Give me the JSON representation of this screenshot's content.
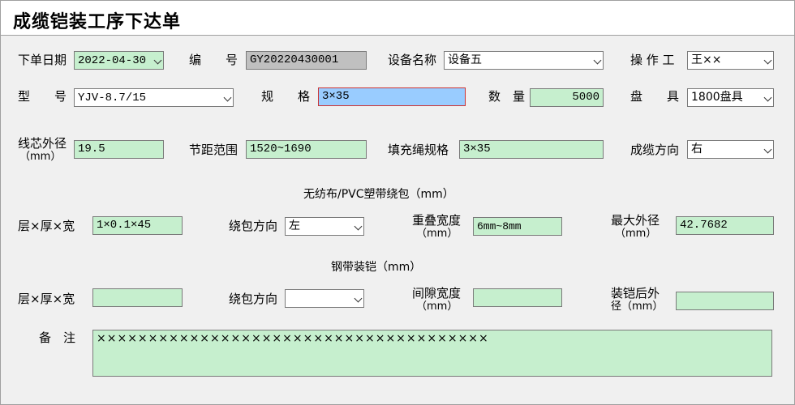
{
  "title": "成缆铠装工序下达单",
  "row1": {
    "order_date_label": "下单日期",
    "order_date_value": "2022-04-30",
    "code_label": "编　　号",
    "code_value": "GY20220430001",
    "equipment_label": "设备名称",
    "equipment_value": "设备五",
    "operator_label": "操 作 工",
    "operator_value": "王××"
  },
  "row2": {
    "model_label": "型　　号",
    "model_value": "YJV-8.7/15",
    "spec_label": "规　　格",
    "spec_value": "3×35",
    "qty_label": "数　量",
    "qty_value": "5000",
    "reel_label": "盘　　具",
    "reel_value": "1800盘具"
  },
  "row3": {
    "core_od_label": "线芯外径",
    "core_od_unit": "（mm）",
    "core_od_value": "19.5",
    "pitch_label": "节距范围",
    "pitch_value": "1520~1690",
    "filler_label": "填充绳规格",
    "filler_value": "3×35",
    "cabling_dir_label": "成缆方向",
    "cabling_dir_value": "右"
  },
  "section_nonwoven": "无纺布/PVC塑带绕包（mm）",
  "row4": {
    "layers_label": "层×厚×宽",
    "layers_value": "1×0.1×45",
    "wrap_dir_label": "绕包方向",
    "wrap_dir_value": "左",
    "overlap_label": "重叠宽度",
    "overlap_unit": "（mm）",
    "overlap_value": "6mm~8mm",
    "max_od_label": "最大外径",
    "max_od_unit": "（mm）",
    "max_od_value": "42.7682"
  },
  "section_steel": "钢带装铠（mm）",
  "row5": {
    "layers_label": "层×厚×宽",
    "layers_value": "",
    "wrap_dir_label": "绕包方向",
    "wrap_dir_value": "",
    "gap_label": "间隙宽度",
    "gap_unit": "（mm）",
    "gap_value": "",
    "armored_od_label": "装铠后外",
    "armored_od_label2": "径（mm）",
    "armored_od_value": ""
  },
  "remark": {
    "label": "备　注",
    "value": "××××××××××××××××××××××××××××××××××××××"
  }
}
